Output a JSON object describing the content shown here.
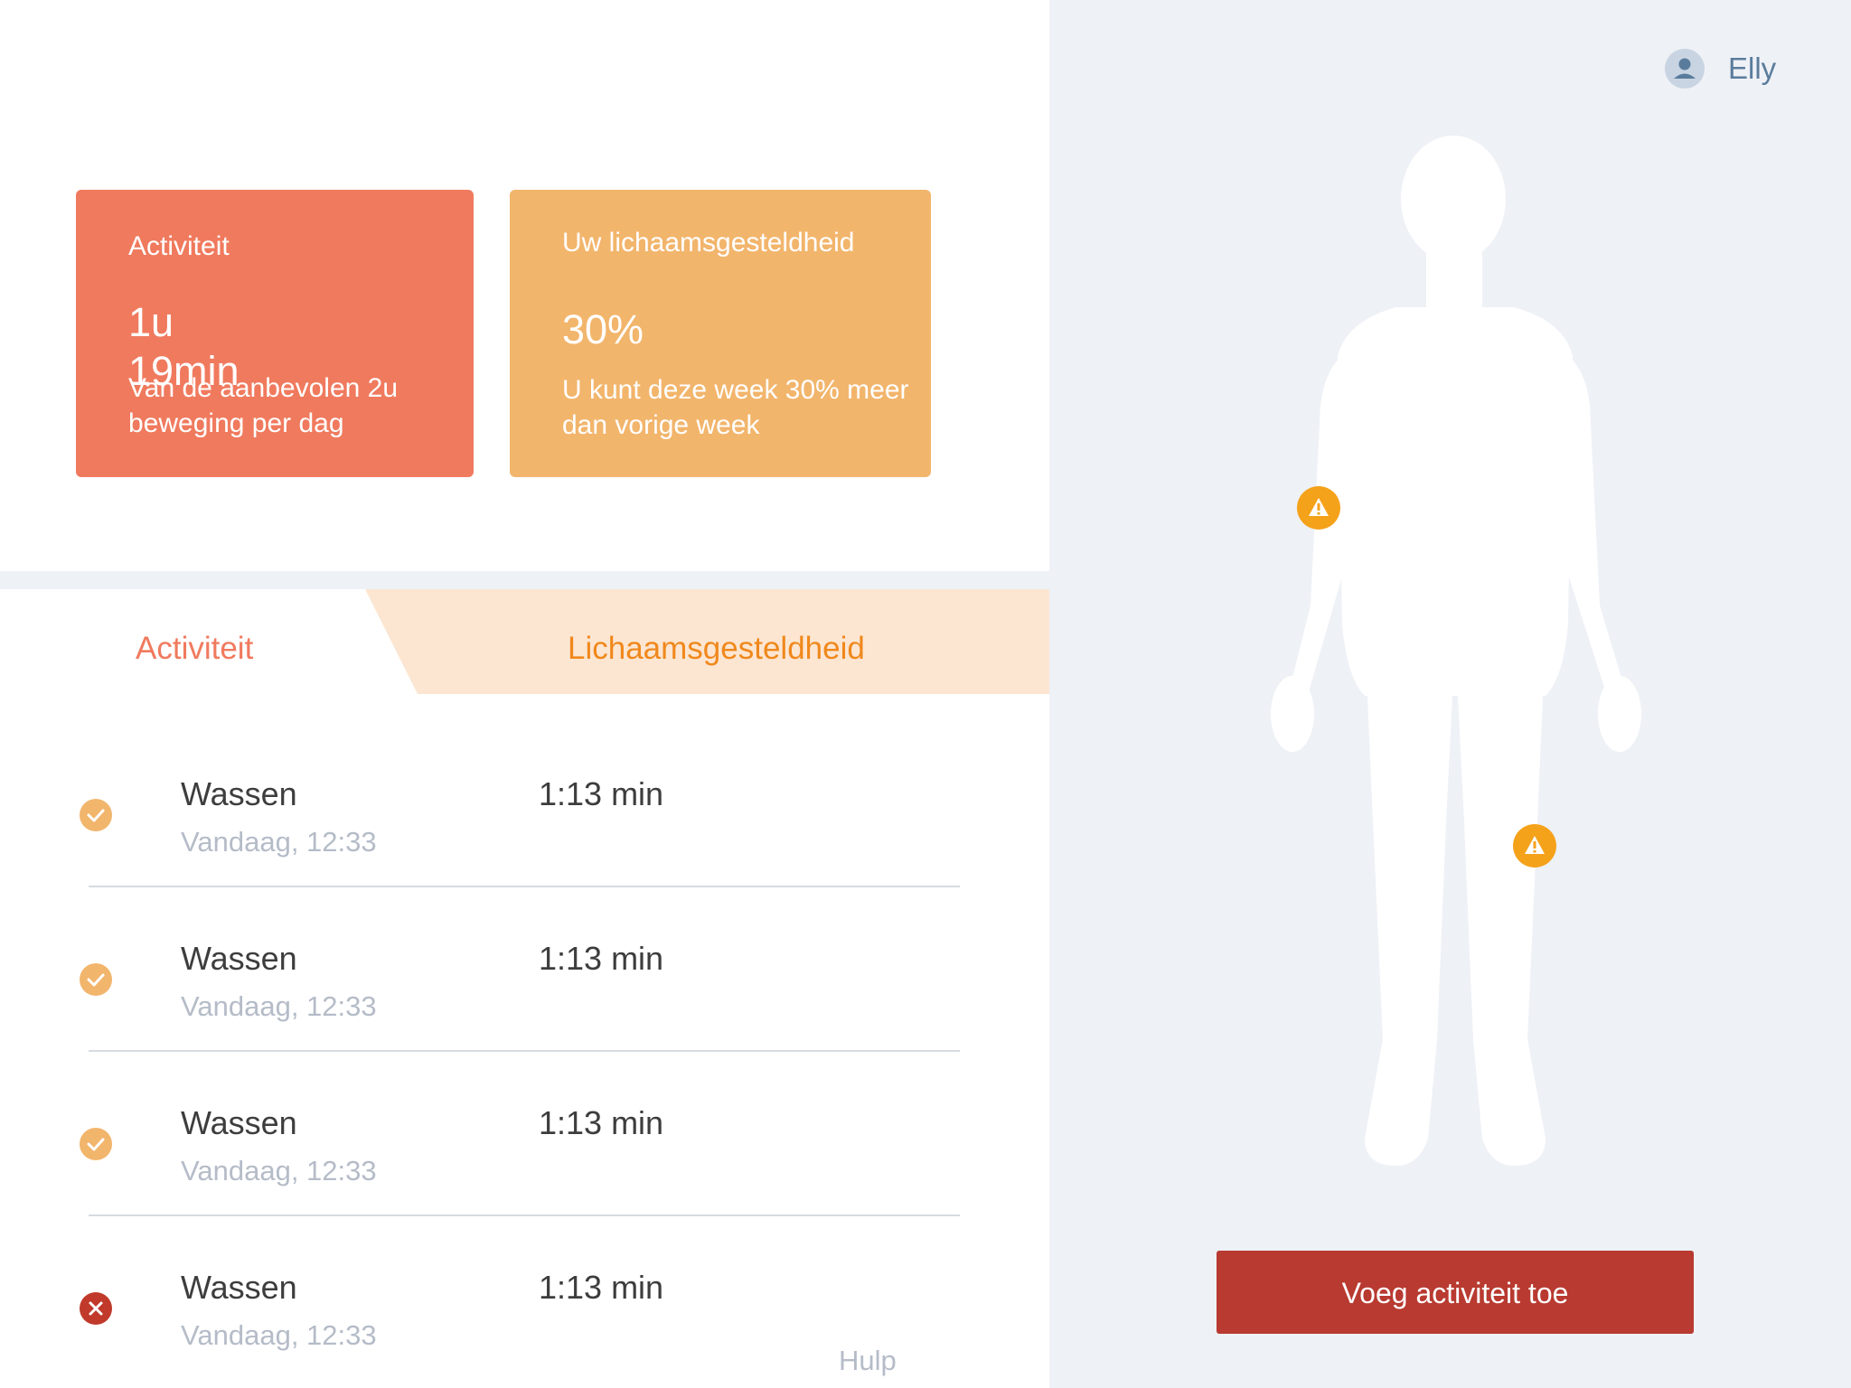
{
  "user": {
    "name": "Elly",
    "avatar_icon": "person-icon"
  },
  "cards": {
    "activity": {
      "title": "Activiteit",
      "value": "1u 19min",
      "description": "Van de aanbevolen 2u beweging per dag",
      "color": "#f07a5e"
    },
    "health": {
      "title": "Uw lichaamsgesteldheid",
      "value": "30%",
      "description": "U kunt deze week 30% meer dan vorige week",
      "color": "#f2b56c"
    }
  },
  "tabs": [
    {
      "label": "Activiteit",
      "active": true
    },
    {
      "label": "Lichaamsgesteldheid",
      "active": false
    }
  ],
  "activities": [
    {
      "name": "Wassen",
      "duration": "1:13 min",
      "time": "Vandaag, 12:33",
      "status": "done",
      "status_icon": "check-circle-icon"
    },
    {
      "name": "Wassen",
      "duration": "1:13 min",
      "time": "Vandaag, 12:33",
      "status": "done",
      "status_icon": "check-circle-icon"
    },
    {
      "name": "Wassen",
      "duration": "1:13 min",
      "time": "Vandaag, 12:33",
      "status": "done",
      "status_icon": "check-circle-icon"
    },
    {
      "name": "Wassen",
      "duration": "1:13 min",
      "time": "Vandaag, 12:33",
      "status": "failed",
      "status_icon": "x-circle-icon"
    }
  ],
  "help_label": "Hulp",
  "body_map": {
    "warning_icon": "warning-icon",
    "warning_count": 2,
    "warning_color": "#f5a21b"
  },
  "add_button_label": "Voeg activiteit toe",
  "colors": {
    "accent_red": "#b83a30",
    "tab_inactive_bg": "#fce6d2",
    "check": "#f2b56c",
    "error": "#c0392b",
    "panel_bg": "#eef1f6"
  }
}
